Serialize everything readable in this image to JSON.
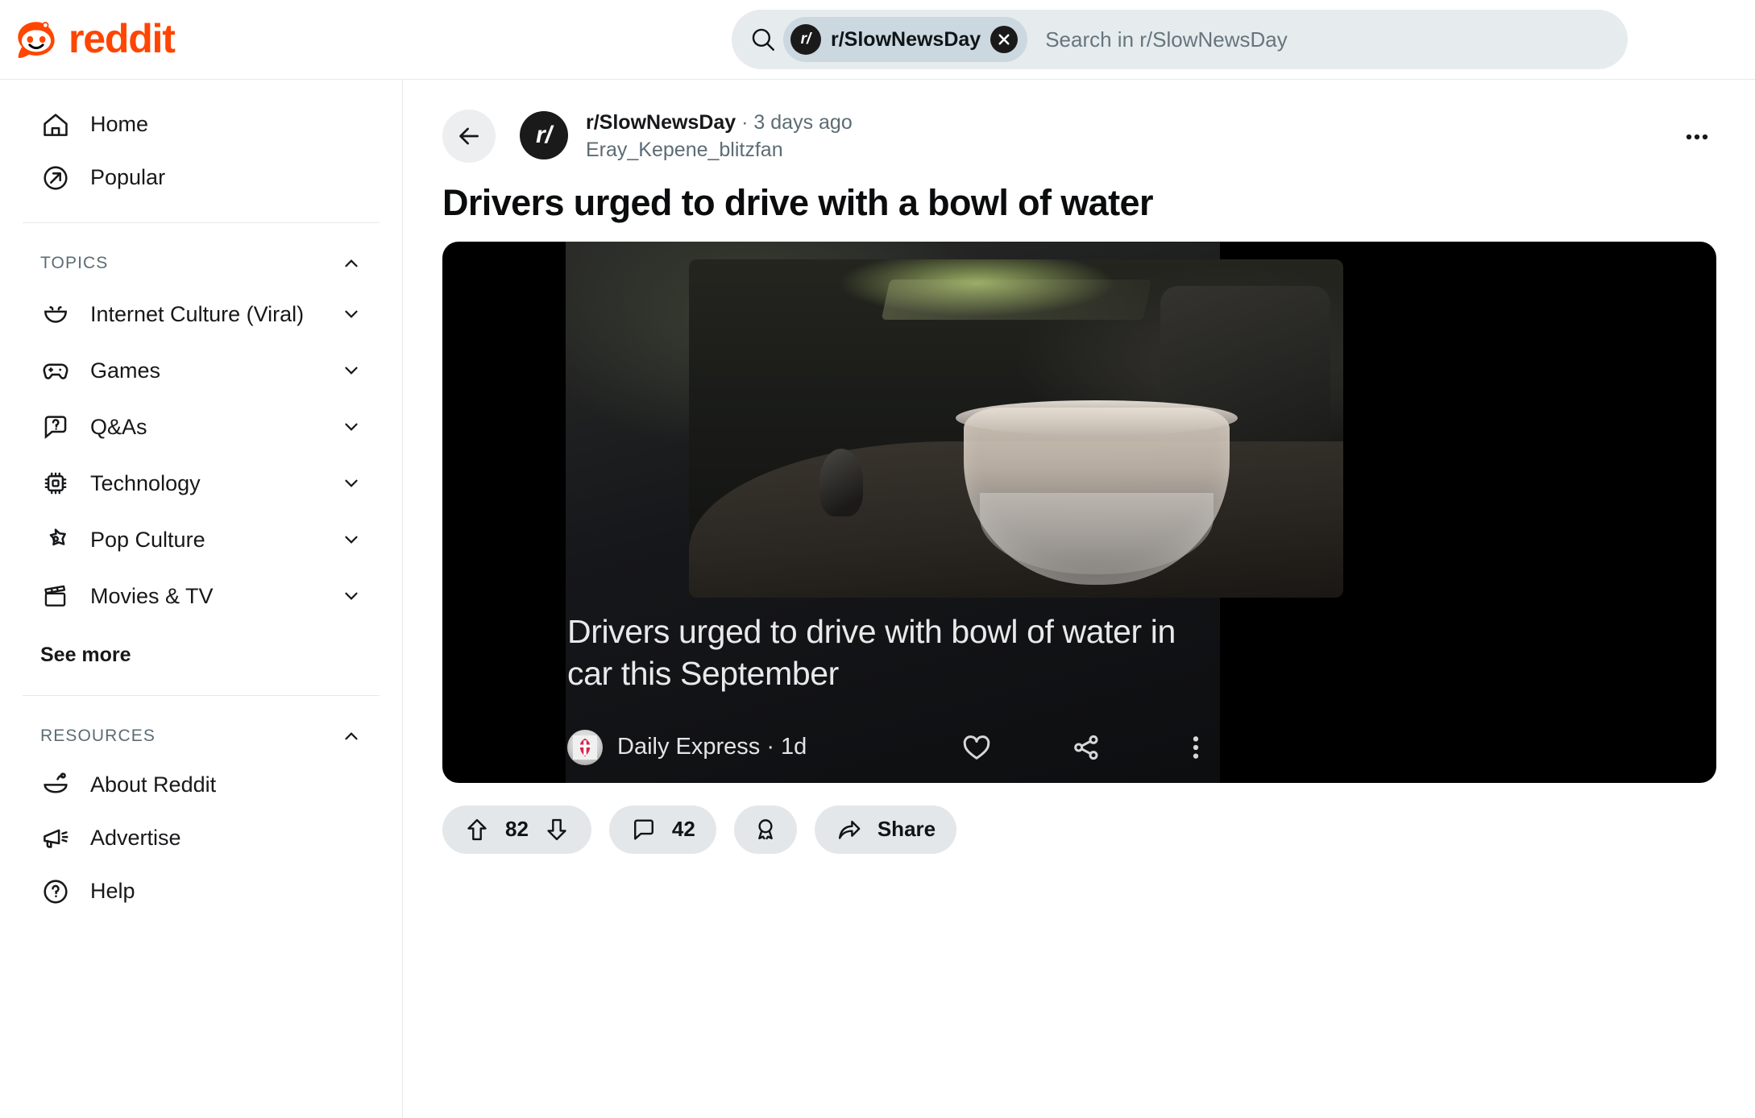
{
  "brand": {
    "name": "reddit",
    "color": "#FF4500",
    "logo_icon": "reddit-snoo-icon"
  },
  "search": {
    "icon": "search-icon",
    "chip": {
      "avatar_text": "r/",
      "label": "r/SlowNewsDay",
      "close_icon": "close-icon"
    },
    "placeholder": "Search in r/SlowNewsDay",
    "value": ""
  },
  "sidebar": {
    "nav": [
      {
        "label": "Home",
        "icon": "home-icon"
      },
      {
        "label": "Popular",
        "icon": "popular-arrow-icon"
      }
    ],
    "topics": {
      "title": "TOPICS",
      "collapse_icon": "chevron-up-icon",
      "items": [
        {
          "label": "Internet Culture (Viral)",
          "icon": "smiley-icon",
          "chevron": "chevron-down-icon"
        },
        {
          "label": "Games",
          "icon": "gamepad-icon",
          "chevron": "chevron-down-icon"
        },
        {
          "label": "Q&As",
          "icon": "question-bubble-icon",
          "chevron": "chevron-down-icon"
        },
        {
          "label": "Technology",
          "icon": "chip-icon",
          "chevron": "chevron-down-icon"
        },
        {
          "label": "Pop Culture",
          "icon": "star-icon",
          "chevron": "chevron-down-icon"
        },
        {
          "label": "Movies & TV",
          "icon": "clapperboard-icon",
          "chevron": "chevron-down-icon"
        }
      ],
      "see_more": "See more"
    },
    "resources": {
      "title": "RESOURCES",
      "collapse_icon": "chevron-up-icon",
      "items": [
        {
          "label": "About Reddit",
          "icon": "snoo-outline-icon"
        },
        {
          "label": "Advertise",
          "icon": "megaphone-icon"
        },
        {
          "label": "Help",
          "icon": "help-circle-icon"
        }
      ]
    }
  },
  "post": {
    "back_icon": "back-arrow-icon",
    "avatar_text": "r/",
    "subreddit": "r/SlowNewsDay",
    "separator": "·",
    "timestamp": "3 days ago",
    "author": "Eray_Kepene_blitzfan",
    "overflow_icon": "more-horizontal-icon",
    "title": "Drivers urged to drive with a bowl of water",
    "video": {
      "caption": "Drivers urged to drive with bowl of water in car this September",
      "source": "Daily Express · 1d",
      "source_avatar": "daily-express-logo-icon",
      "actions": [
        {
          "icon": "heart-icon"
        },
        {
          "icon": "share-nodes-icon"
        },
        {
          "icon": "more-vertical-icon"
        }
      ]
    },
    "actions": {
      "upvote_icon": "upvote-arrow-icon",
      "score": "82",
      "downvote_icon": "downvote-arrow-icon",
      "comment_icon": "comment-bubble-icon",
      "comment_count": "42",
      "award_icon": "award-ribbon-icon",
      "share_icon": "share-arrow-icon",
      "share_label": "Share"
    }
  }
}
